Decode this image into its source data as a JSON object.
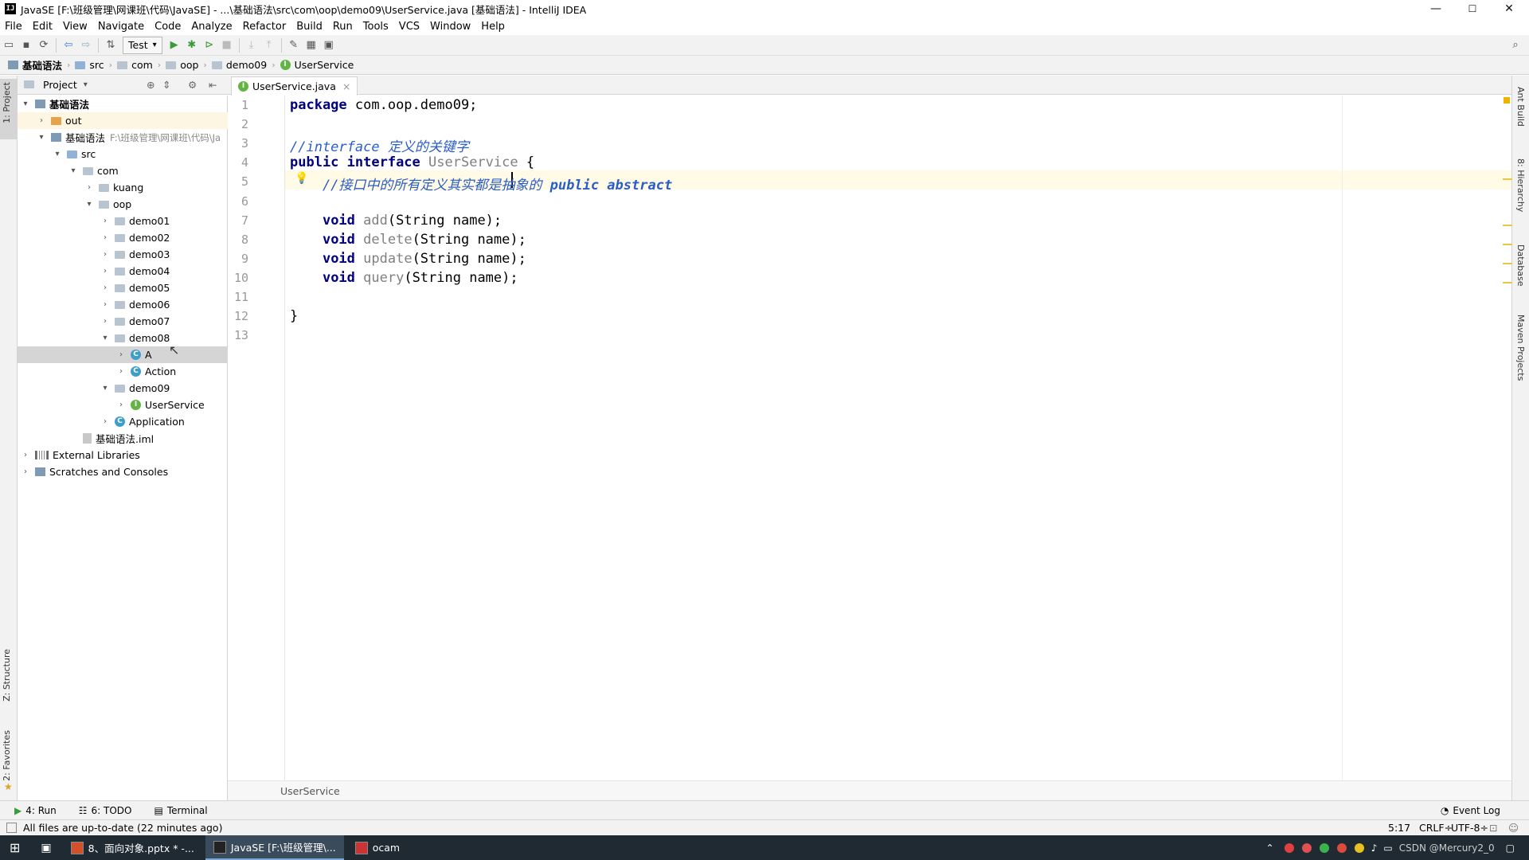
{
  "window": {
    "title": "JavaSE [F:\\班级管理\\网课班\\代码\\JavaSE] - ...\\基础语法\\src\\com\\oop\\demo09\\UserService.java [基础语法] - IntelliJ IDEA",
    "app_icon": "IJ",
    "controls": {
      "minimize": "—",
      "maximize": "☐",
      "close": "✕"
    }
  },
  "menu": [
    "File",
    "Edit",
    "View",
    "Navigate",
    "Code",
    "Analyze",
    "Refactor",
    "Build",
    "Run",
    "Tools",
    "VCS",
    "Window",
    "Help"
  ],
  "toolbar": {
    "run_config": "Test",
    "run_config_arrow": "▾"
  },
  "breadcrumb": [
    "基础语法",
    "src",
    "com",
    "oop",
    "demo09",
    "UserService"
  ],
  "left_tabs": {
    "project": "1: Project",
    "structure": "Z: Structure",
    "favorites": "2: Favorites"
  },
  "right_tabs": {
    "ant": "Ant Build",
    "hierarchy": "8: Hierarchy",
    "database": "Database",
    "maven": "Maven Projects"
  },
  "project_panel": {
    "title": "Project",
    "tree": [
      {
        "label": "基础语法",
        "arrow": "▾",
        "icon": "module",
        "level": 0
      },
      {
        "label": "out",
        "arrow": "›",
        "icon": "folder-orange",
        "level": 1
      },
      {
        "label": "基础语法",
        "detail": "F:\\班级管理\\网课班\\代码\\Ja",
        "arrow": "▾",
        "icon": "module",
        "level": 1
      },
      {
        "label": "src",
        "arrow": "▾",
        "icon": "folder-blue",
        "level": 2
      },
      {
        "label": "com",
        "arrow": "▾",
        "icon": "folder",
        "level": 3
      },
      {
        "label": "kuang",
        "arrow": "›",
        "icon": "folder",
        "level": 4
      },
      {
        "label": "oop",
        "arrow": "▾",
        "icon": "folder",
        "level": 4
      },
      {
        "label": "demo01",
        "arrow": "›",
        "icon": "folder",
        "level": 5
      },
      {
        "label": "demo02",
        "arrow": "›",
        "icon": "folder",
        "level": 5
      },
      {
        "label": "demo03",
        "arrow": "›",
        "icon": "folder",
        "level": 5
      },
      {
        "label": "demo04",
        "arrow": "›",
        "icon": "folder",
        "level": 5
      },
      {
        "label": "demo05",
        "arrow": "›",
        "icon": "folder",
        "level": 5
      },
      {
        "label": "demo06",
        "arrow": "›",
        "icon": "folder",
        "level": 5
      },
      {
        "label": "demo07",
        "arrow": "›",
        "icon": "folder",
        "level": 5
      },
      {
        "label": "demo08",
        "arrow": "▾",
        "icon": "folder",
        "level": 5
      },
      {
        "label": "A",
        "arrow": "›",
        "icon": "class",
        "level": 6,
        "selected": true
      },
      {
        "label": "Action",
        "arrow": "›",
        "icon": "class",
        "level": 6
      },
      {
        "label": "demo09",
        "arrow": "▾",
        "icon": "folder",
        "level": 5
      },
      {
        "label": "UserService",
        "arrow": "›",
        "icon": "interface",
        "level": 6
      },
      {
        "label": "Application",
        "arrow": "›",
        "icon": "class",
        "level": 5
      },
      {
        "label": "基础语法.iml",
        "arrow": "",
        "icon": "file",
        "level": 3
      },
      {
        "label": "External Libraries",
        "arrow": "›",
        "icon": "library",
        "level": 0
      },
      {
        "label": "Scratches and Consoles",
        "arrow": "›",
        "icon": "scratch",
        "level": 0
      }
    ]
  },
  "editor": {
    "tab": {
      "label": "UserService.java",
      "close": "×"
    },
    "line_numbers": [
      "1",
      "2",
      "3",
      "4",
      "5",
      "6",
      "7",
      "8",
      "9",
      "10",
      "11",
      "12",
      "13"
    ],
    "lines": [
      [
        {
          "t": "package ",
          "c": "kw"
        },
        {
          "t": "com.oop.demo09;",
          "c": ""
        }
      ],
      [],
      [
        {
          "t": "//interface 定义的关键字",
          "c": "cm"
        }
      ],
      [
        {
          "t": "public ",
          "c": "kw"
        },
        {
          "t": "interface ",
          "c": "kw"
        },
        {
          "t": "UserService",
          "c": "unused"
        },
        {
          "t": " {",
          "c": ""
        }
      ],
      [
        {
          "t": "    //接口中的所有定义其实都是抽象的 ",
          "c": "cm"
        },
        {
          "t": "public abstract",
          "c": "cmb"
        }
      ],
      [],
      [
        {
          "t": "    ",
          "c": ""
        },
        {
          "t": "void ",
          "c": "kw"
        },
        {
          "t": "add",
          "c": "unused"
        },
        {
          "t": "(String name);",
          "c": ""
        }
      ],
      [
        {
          "t": "    ",
          "c": ""
        },
        {
          "t": "void ",
          "c": "kw"
        },
        {
          "t": "delete",
          "c": "unused"
        },
        {
          "t": "(String name);",
          "c": ""
        }
      ],
      [
        {
          "t": "    ",
          "c": ""
        },
        {
          "t": "void ",
          "c": "kw"
        },
        {
          "t": "update",
          "c": "unused"
        },
        {
          "t": "(String name);",
          "c": ""
        }
      ],
      [
        {
          "t": "    ",
          "c": ""
        },
        {
          "t": "void ",
          "c": "kw"
        },
        {
          "t": "query",
          "c": "unused"
        },
        {
          "t": "(String name);",
          "c": ""
        }
      ],
      [],
      [
        {
          "t": "}",
          "c": ""
        }
      ],
      []
    ],
    "footer_breadcrumb": "UserService",
    "bulb_icon": "💡"
  },
  "tool_windows": [
    {
      "label": "4: Run",
      "icon": "▶"
    },
    {
      "label": "6: TODO",
      "icon": "☷"
    },
    {
      "label": "Terminal",
      "icon": "▤"
    }
  ],
  "event_log": "Event Log",
  "status": {
    "message": "All files are up-to-date (22 minutes ago)",
    "position": "5:17",
    "line_sep": "CRLF÷",
    "encoding": "UTF-8÷"
  },
  "taskbar": {
    "items": [
      {
        "label": "8、面向对象.pptx * -...",
        "active": false
      },
      {
        "label": "JavaSE [F:\\班级管理\\...",
        "active": true
      },
      {
        "label": "ocam",
        "active": false
      }
    ],
    "watermark": "CSDN @Mercury2_0"
  },
  "colors": {
    "keyword": "#000080",
    "comment": "#2a5ec6",
    "unused": "#808080",
    "selection": "#d5d5d5"
  }
}
